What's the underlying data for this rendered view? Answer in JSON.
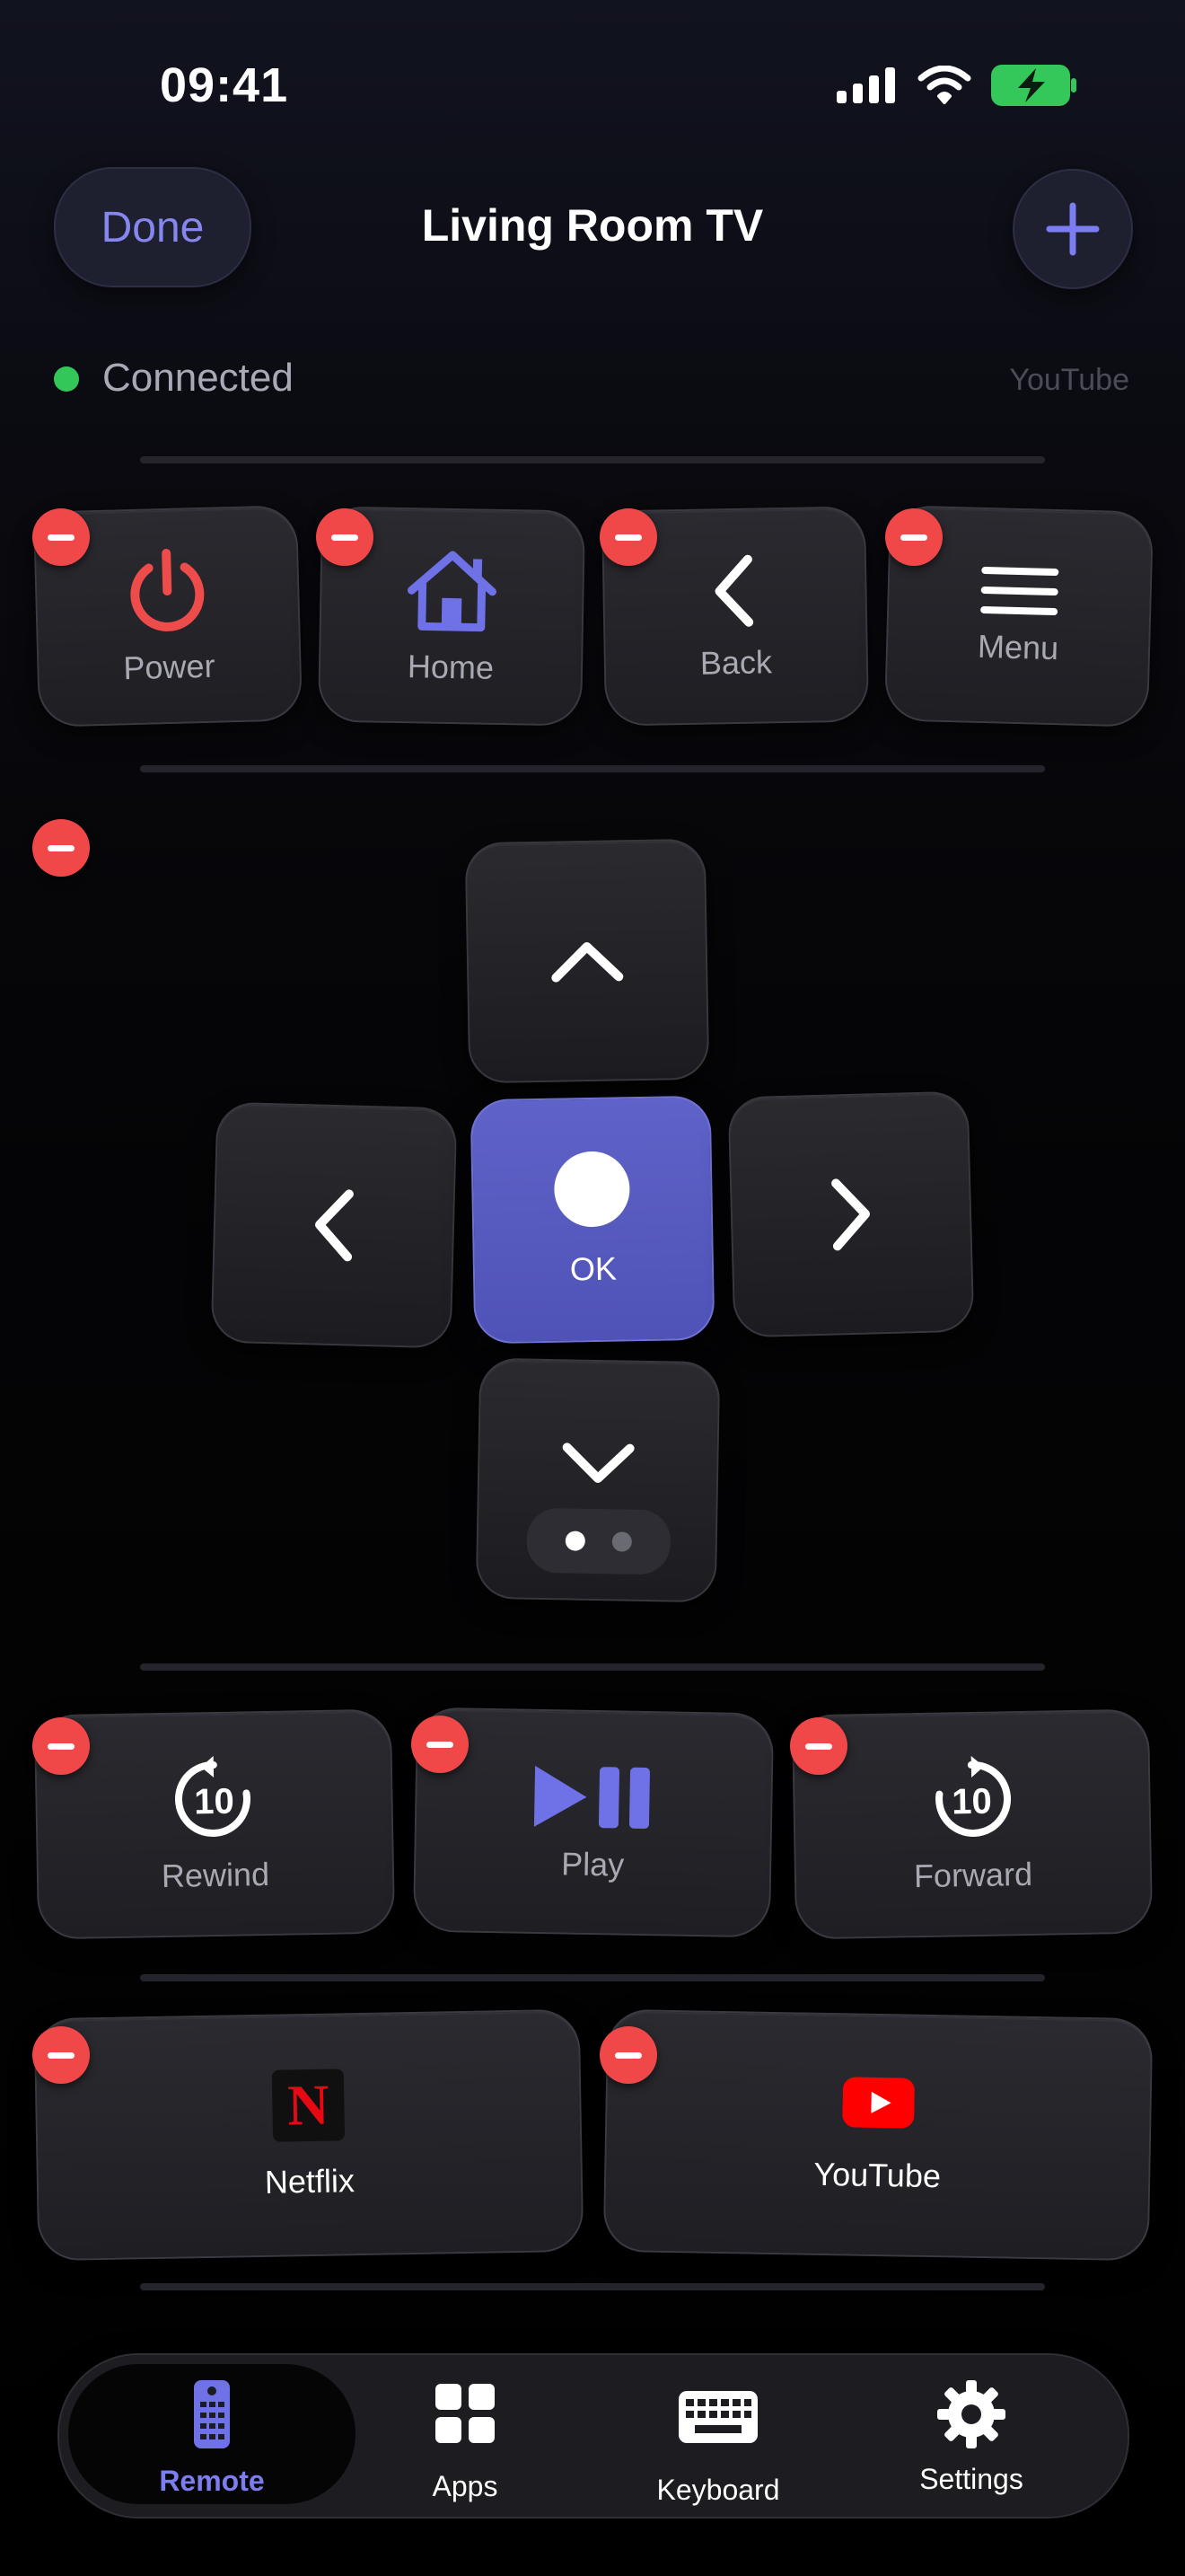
{
  "status_bar": {
    "time": "09:41"
  },
  "header": {
    "done_label": "Done",
    "title": "Living Room TV"
  },
  "connection": {
    "status": "Connected",
    "active_app": "YouTube",
    "status_color": "#33c759"
  },
  "nav_row": [
    {
      "label": "Power",
      "icon": "power-icon",
      "color": "#ee4b4b"
    },
    {
      "label": "Home",
      "icon": "home-icon",
      "color": "#6f71e6"
    },
    {
      "label": "Back",
      "icon": "chevron-left-icon",
      "color": "#ffffff"
    },
    {
      "label": "Menu",
      "icon": "menu-icon",
      "color": "#ffffff"
    }
  ],
  "dpad": {
    "ok_label": "OK",
    "page_count": 2,
    "active_page": 1
  },
  "media_row": [
    {
      "label": "Rewind",
      "icon": "rewind-10-icon",
      "badge": "10"
    },
    {
      "label": "Play",
      "icon": "play-pause-icon"
    },
    {
      "label": "Forward",
      "icon": "forward-10-icon",
      "badge": "10"
    }
  ],
  "apps_row": [
    {
      "label": "Netflix",
      "icon": "netflix-logo",
      "logo_text": "N"
    },
    {
      "label": "YouTube",
      "icon": "youtube-logo"
    }
  ],
  "tabbar": {
    "active": "Remote",
    "accent": "#6f71e6",
    "items": [
      {
        "label": "Remote",
        "icon": "remote-icon"
      },
      {
        "label": "Apps",
        "icon": "grid-icon"
      },
      {
        "label": "Keyboard",
        "icon": "keyboard-icon"
      },
      {
        "label": "Settings",
        "icon": "gear-icon"
      }
    ]
  }
}
